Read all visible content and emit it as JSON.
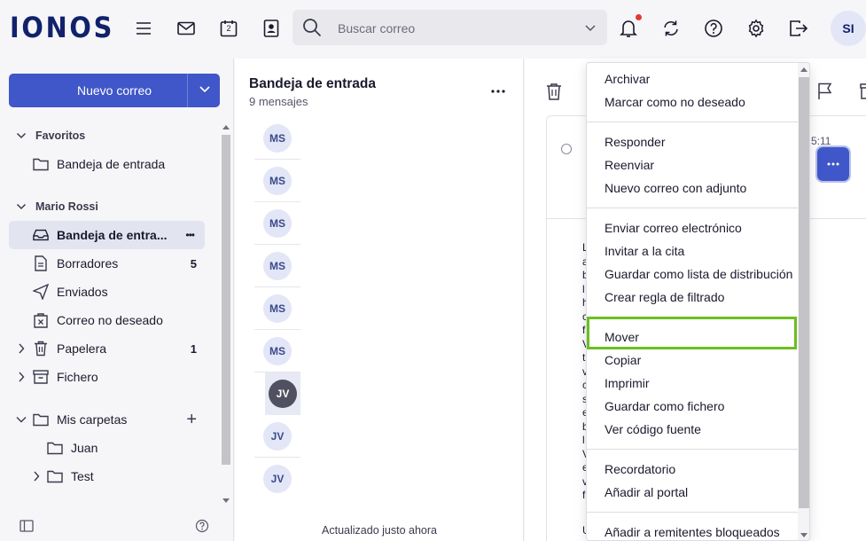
{
  "brand": {
    "logo_text": "IONOS"
  },
  "header": {
    "search_placeholder": "Buscar correo",
    "calendar_day": "2",
    "avatar_initials": "SI"
  },
  "sidebar": {
    "new_mail_label": "Nuevo correo",
    "favorites_label": "Favoritos",
    "favorites_items": [
      {
        "label": "Bandeja de entrada"
      }
    ],
    "account_label": "Mario Rossi",
    "account_items": [
      {
        "label": "Bandeja de entra...",
        "count": ""
      },
      {
        "label": "Borradores",
        "count": "5"
      },
      {
        "label": "Enviados",
        "count": ""
      },
      {
        "label": "Correo no deseado",
        "count": ""
      },
      {
        "label": "Papelera",
        "count": "1"
      },
      {
        "label": "Fichero",
        "count": ""
      },
      {
        "label": "Mis carpetas",
        "count": ""
      },
      {
        "label": "Juan",
        "count": ""
      },
      {
        "label": "Test",
        "count": ""
      }
    ],
    "active_more": "•••",
    "add_folder": "+"
  },
  "message_list": {
    "title": "Bandeja de entrada",
    "subtitle": "9 mensajes",
    "rows": [
      {
        "initials": "MS"
      },
      {
        "initials": "MS"
      },
      {
        "initials": "MS"
      },
      {
        "initials": "MS"
      },
      {
        "initials": "MS"
      },
      {
        "initials": "MS"
      },
      {
        "initials": "JV"
      },
      {
        "initials": "JV"
      },
      {
        "initials": "JV"
      }
    ],
    "footer": "Actualizado justo ahora"
  },
  "reading_pane": {
    "time_partial": "5:11",
    "body_letters": [
      "L",
      "a",
      "b",
      "l",
      "h",
      "c",
      "f",
      "V",
      "t",
      "v",
      "c",
      "s",
      "e",
      "b",
      "l",
      "V",
      "e",
      "v",
      "f"
    ],
    "bottom_letter": "U"
  },
  "context_menu": {
    "items": [
      "Archivar",
      "Marcar como no deseado",
      "Responder",
      "Reenviar",
      "Nuevo correo con adjunto",
      "Enviar correo electrónico",
      "Invitar a la cita",
      "Guardar como lista de distribución",
      "Crear regla de filtrado",
      "Mover",
      "Copiar",
      "Imprimir",
      "Guardar como fichero",
      "Ver código fuente",
      "Recordatorio",
      "Añadir al portal",
      "Añadir a remitentes bloqueados"
    ],
    "highlighted_item": "Mover"
  },
  "colors": {
    "brand": "#11226b",
    "primary_button": "#3f57c8",
    "highlight_outline": "#6bbf1f",
    "notification_dot": "#e53935"
  },
  "icons": {
    "menu": "hamburger-icon",
    "mail": "envelope-icon",
    "calendar": "calendar-icon",
    "contacts": "contacts-icon",
    "search": "search-icon",
    "bell": "bell-icon",
    "sync": "sync-icon",
    "help": "help-icon",
    "settings": "gear-icon",
    "logout": "logout-icon"
  }
}
